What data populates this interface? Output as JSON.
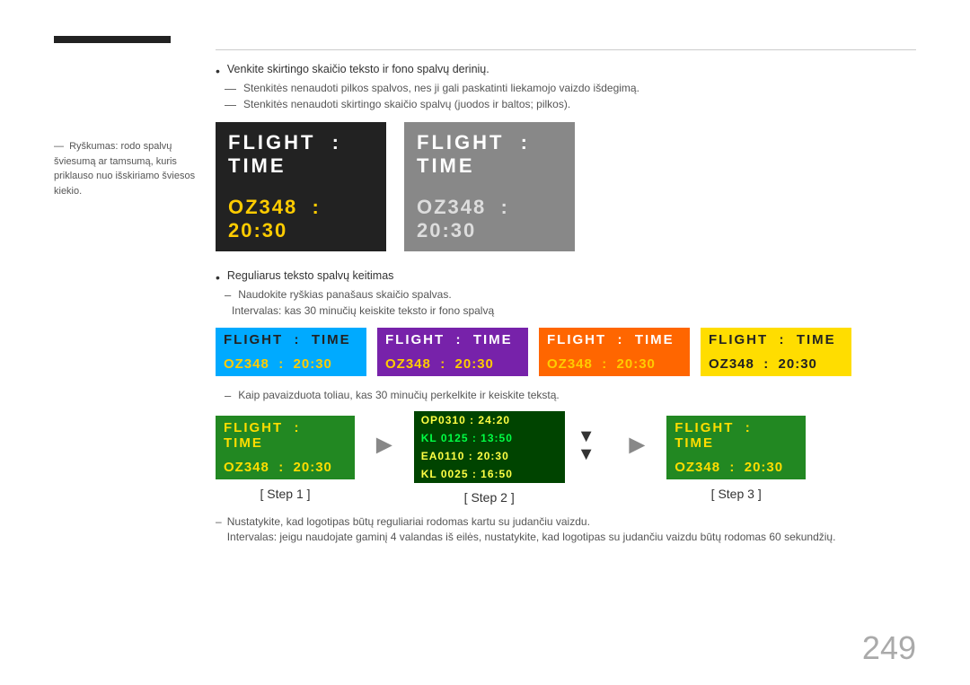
{
  "page": {
    "number": "249"
  },
  "sidebar": {
    "note_dash": "—",
    "note_text": "Ryškumas: rodo spalvų šviesumą ar tamsumą, kuris priklauso nuo išskiriamo šviesos kiekio."
  },
  "bullets": {
    "item1": "Venkite skirtingo skaičio teksto ir fono spalvų derinių.",
    "dash1": "Stenkitės nenaudoti pilkos spalvos, nes ji gali paskatinti liekamojo vaizdo išdegimą.",
    "dash2": "Stenkitės nenaudoti skirtingo skaičio spalvų (juodos ir baltos; pilkos).",
    "item2": "Reguliarus teksto spalvų keitimas",
    "dash3": "Naudokite ryškias panašaus skaičio spalvas.",
    "dash4": "Intervalas: kas 30 minučių keiskite teksto ir fono spalvą",
    "dash5": "Kaip pavaizduota toliau, kas 30 minučių perkelkite ir keiskite tekstą.",
    "dash6": "Nustatykite, kad logotipas būtų reguliariai rodomas kartu su judančiu vaizdu.",
    "dash7": "Intervalas: jeigu naudojate gaminį 4 valandas iš eilės, nustatykite, kad logotipas su judančiu vaizdu būtų rodomas 60 sekundžių."
  },
  "large_cards": [
    {
      "id": "dark",
      "header": "FLIGHT  :  TIME",
      "body": "OZ348  :  20:30",
      "header_bg": "#222222",
      "header_color": "#ffffff",
      "body_bg": "#222222",
      "body_color": "#ffcc00"
    },
    {
      "id": "gray",
      "header": "FLIGHT  :  TIME",
      "body": "OZ348  :  20:30",
      "header_bg": "#999999",
      "header_color": "#ffffff",
      "body_bg": "#999999",
      "body_color": "#cccccc"
    }
  ],
  "small_cards": [
    {
      "id": "cyan",
      "header": "FLIGHT  :  TIME",
      "body": "OZ348  :  20:30",
      "header_bg": "#00aaff",
      "header_color": "#222222",
      "body_bg": "#00aaff",
      "body_color": "#ffcc00"
    },
    {
      "id": "purple",
      "header": "FLIGHT  :  TIME",
      "body": "OZ348  :  20:30",
      "header_bg": "#7b1fa2",
      "header_color": "#ffffff",
      "body_bg": "#7b1fa2",
      "body_color": "#ffdd00"
    },
    {
      "id": "orange",
      "header": "FLIGHT  :  TIME",
      "body": "OZ348  :  20:30",
      "header_bg": "#ff6600",
      "header_color": "#ffffff",
      "body_bg": "#ff6600",
      "body_color": "#ffdd00"
    },
    {
      "id": "yellow",
      "header": "FLIGHT  :  TIME",
      "body": "OZ348  :  20:30",
      "header_bg": "#ddcc00",
      "header_color": "#222222",
      "body_bg": "#ddcc00",
      "body_color": "#222222"
    }
  ],
  "steps": {
    "step1": {
      "label": "[ Step 1 ]",
      "header": "FLIGHT  :  TIME",
      "body": "OZ348  :  20:30",
      "header_bg": "#228822",
      "header_color": "#ffee00",
      "body_bg": "#228822",
      "body_color": "#ffee00"
    },
    "step2": {
      "label": "[ Step 2 ]",
      "rows": [
        {
          "text": "OP0310 : 24:20",
          "highlight": false
        },
        {
          "text": "KL0125 : 13:50",
          "highlight": true
        },
        {
          "text": "EA0110 : 20:30",
          "highlight": false
        },
        {
          "text": "KL0025 : 16:50",
          "highlight": false
        }
      ]
    },
    "step3": {
      "label": "[ Step 3 ]",
      "header": "FLIGHT  :  TIME",
      "body": "OZ348  :  20:30",
      "header_bg": "#228822",
      "header_color": "#ffee00",
      "body_bg": "#228822",
      "body_color": "#ffee00"
    }
  }
}
